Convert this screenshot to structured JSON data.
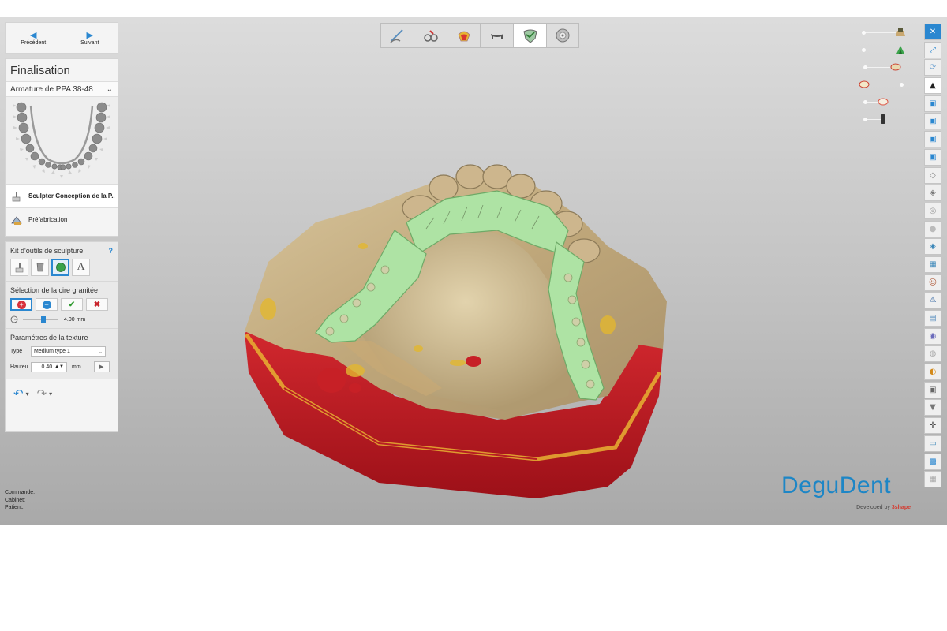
{
  "nav": {
    "prev_label": "Précédent",
    "next_label": "Suivant"
  },
  "stage": {
    "title": "Finalisation",
    "dropdown_value": "Armature de PPA 38-48",
    "steps": [
      {
        "label": "Sculpter Conception de la P..",
        "icon": "sculpt-hand-icon",
        "active": true
      },
      {
        "label": "Préfabrication",
        "icon": "prefab-icon",
        "active": false
      }
    ]
  },
  "sculpt_kit": {
    "title": "Kit d'outils de sculpture",
    "help": "?",
    "tools": [
      "sculpt-hand-tool",
      "wax-knife-tool",
      "granite-wax-tool",
      "text-tool"
    ],
    "selected_tool": 2,
    "text_tool_glyph": "A"
  },
  "wax": {
    "title": "Sélection de la cire granitée",
    "buttons": [
      {
        "name": "add-wax",
        "glyph": "+",
        "color": "#d8313b"
      },
      {
        "name": "remove-wax",
        "glyph": "−",
        "color": "#2a87d0"
      },
      {
        "name": "accept",
        "glyph": "✔",
        "color": "#2e9a2e"
      },
      {
        "name": "cancel",
        "glyph": "✖",
        "color": "#c8232b"
      }
    ],
    "size_value": "4.00 mm",
    "size_level": 0.6
  },
  "texture": {
    "title": "Paramétres de la texture",
    "type_label": "Type",
    "type_value": "Medium type 1",
    "height_label": "Hauteu",
    "height_value": "0.40",
    "height_unit": "mm"
  },
  "top_toolbar": {
    "items": [
      "design-icon",
      "clasp-icon",
      "retention-icon",
      "connector-icon",
      "finalize-icon",
      "export-icon"
    ],
    "active_index": 4
  },
  "right_toolbar": [
    "close-icon",
    "fit-view-icon",
    "rotate-icon",
    "cap-icon",
    "view-front-icon",
    "view-back-icon",
    "view-left-icon",
    "view-right-icon",
    "clip-icon",
    "measure-icon",
    "zoom-icon",
    "sphere-icon",
    "model-icon",
    "cube-icon",
    "face-icon",
    "warning-icon",
    "layer-icon",
    "palette-icon",
    "texture-icon",
    "teeth-icon",
    "camera-icon",
    "filter-icon",
    "crosshair-icon",
    "ruler-icon",
    "scan-icon",
    "stack-icon"
  ],
  "brand": {
    "logo": "DeguDent",
    "developed_by": "Developed by ",
    "developer": "3shape"
  },
  "info": {
    "order_label": "Commande:",
    "clinic_label": "Cabinet:",
    "patient_label": "Patient:"
  },
  "colors": {
    "accent": "#2a87d0",
    "gingiva": "#c8b48c",
    "framework": "#a8e0a0",
    "model_base": "#c41e2a"
  }
}
